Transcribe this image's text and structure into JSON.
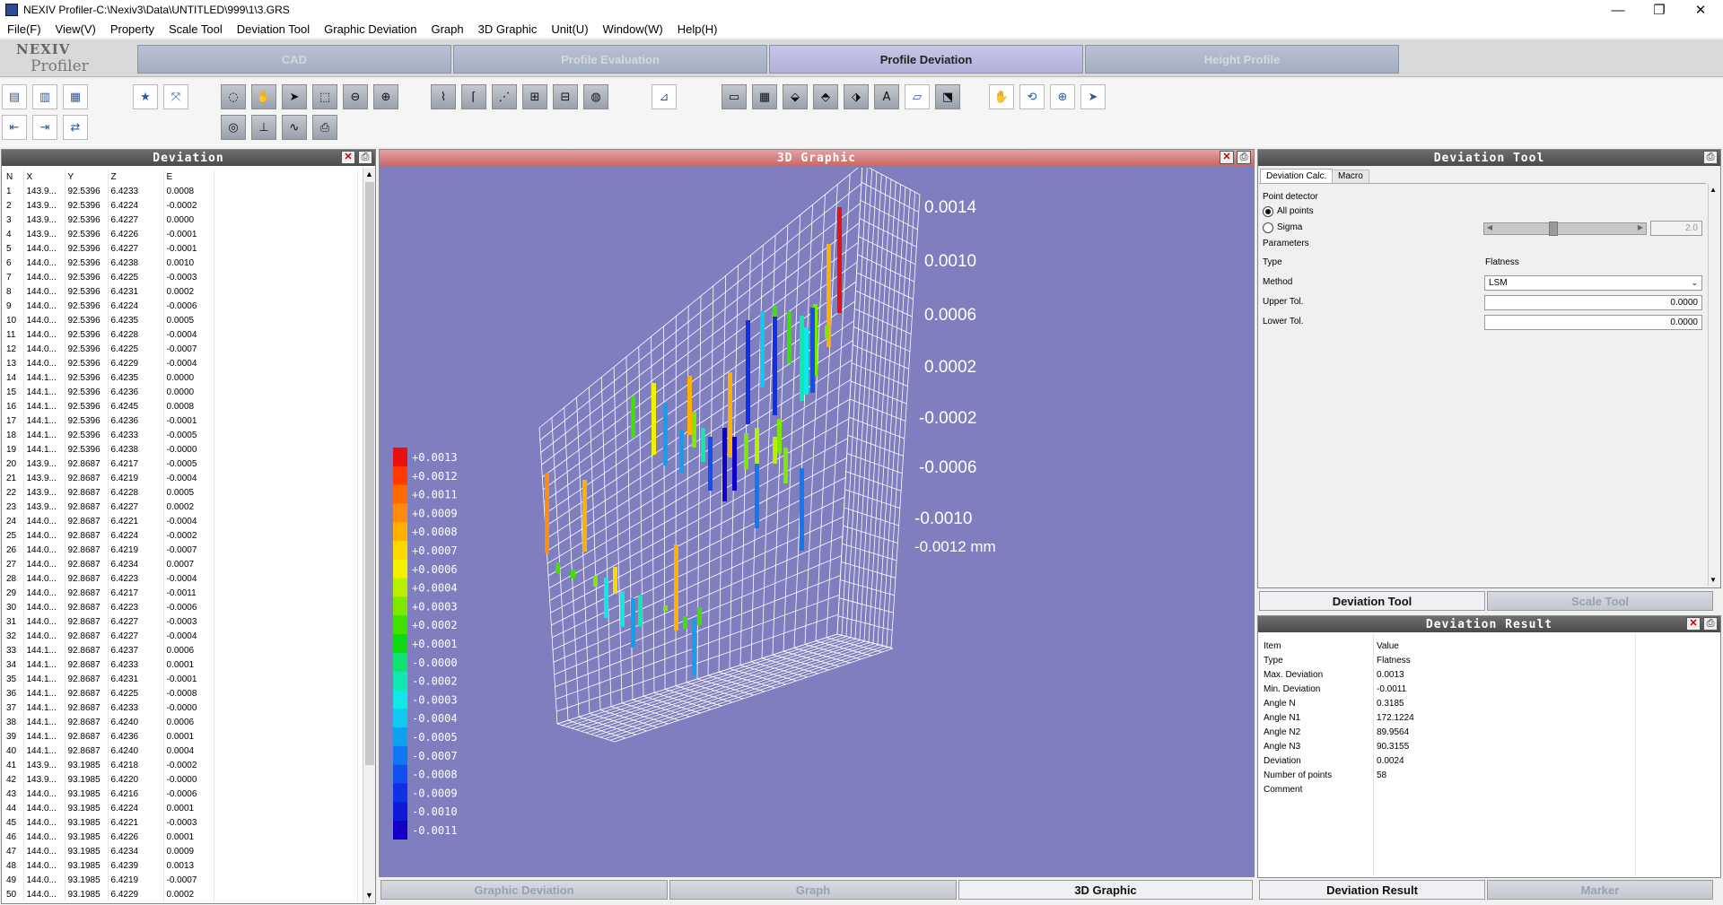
{
  "window": {
    "title": "NEXIV Profiler-C:\\Nexiv3\\Data\\UNTITLED\\999\\1\\3.GRS",
    "minimize": "—",
    "maximize": "❐",
    "close": "✕"
  },
  "menu": [
    "File(F)",
    "View(V)",
    "Property",
    "Scale Tool",
    "Deviation Tool",
    "Graphic Deviation",
    "Graph",
    "3D Graphic",
    "Unit(U)",
    "Window(W)",
    "Help(H)"
  ],
  "logo": {
    "line1": "NEXIV",
    "line2": "Profiler"
  },
  "main_tabs": [
    {
      "label": "CAD"
    },
    {
      "label": "Profile Evaluation"
    },
    {
      "label": "Profile Deviation",
      "active": true
    },
    {
      "label": "Height Profile"
    }
  ],
  "deviation_panel": {
    "title": "Deviation",
    "columns": [
      "N",
      "X",
      "Y",
      "Z",
      "E"
    ],
    "rows": [
      [
        "1",
        "143.9...",
        "92.5396",
        "6.4233",
        "0.0008"
      ],
      [
        "2",
        "143.9...",
        "92.5396",
        "6.4224",
        "-0.0002"
      ],
      [
        "3",
        "143.9...",
        "92.5396",
        "6.4227",
        "0.0000"
      ],
      [
        "4",
        "143.9...",
        "92.5396",
        "6.4226",
        "-0.0001"
      ],
      [
        "5",
        "144.0...",
        "92.5396",
        "6.4227",
        "-0.0001"
      ],
      [
        "6",
        "144.0...",
        "92.5396",
        "6.4238",
        "0.0010"
      ],
      [
        "7",
        "144.0...",
        "92.5396",
        "6.4225",
        "-0.0003"
      ],
      [
        "8",
        "144.0...",
        "92.5396",
        "6.4231",
        "0.0002"
      ],
      [
        "9",
        "144.0...",
        "92.5396",
        "6.4224",
        "-0.0006"
      ],
      [
        "10",
        "144.0...",
        "92.5396",
        "6.4235",
        "0.0005"
      ],
      [
        "11",
        "144.0...",
        "92.5396",
        "6.4228",
        "-0.0004"
      ],
      [
        "12",
        "144.0...",
        "92.5396",
        "6.4225",
        "-0.0007"
      ],
      [
        "13",
        "144.0...",
        "92.5396",
        "6.4229",
        "-0.0004"
      ],
      [
        "14",
        "144.1...",
        "92.5396",
        "6.4235",
        "0.0000"
      ],
      [
        "15",
        "144.1...",
        "92.5396",
        "6.4236",
        "0.0000"
      ],
      [
        "16",
        "144.1...",
        "92.5396",
        "6.4245",
        "0.0008"
      ],
      [
        "17",
        "144.1...",
        "92.5396",
        "6.4236",
        "-0.0001"
      ],
      [
        "18",
        "144.1...",
        "92.5396",
        "6.4233",
        "-0.0005"
      ],
      [
        "19",
        "144.1...",
        "92.5396",
        "6.4238",
        "-0.0000"
      ],
      [
        "20",
        "143.9...",
        "92.8687",
        "6.4217",
        "-0.0005"
      ],
      [
        "21",
        "143.9...",
        "92.8687",
        "6.4219",
        "-0.0004"
      ],
      [
        "22",
        "143.9...",
        "92.8687",
        "6.4228",
        "0.0005"
      ],
      [
        "23",
        "143.9...",
        "92.8687",
        "6.4227",
        "0.0002"
      ],
      [
        "24",
        "144.0...",
        "92.8687",
        "6.4221",
        "-0.0004"
      ],
      [
        "25",
        "144.0...",
        "92.8687",
        "6.4224",
        "-0.0002"
      ],
      [
        "26",
        "144.0...",
        "92.8687",
        "6.4219",
        "-0.0007"
      ],
      [
        "27",
        "144.0...",
        "92.8687",
        "6.4234",
        "0.0007"
      ],
      [
        "28",
        "144.0...",
        "92.8687",
        "6.4223",
        "-0.0004"
      ],
      [
        "29",
        "144.0...",
        "92.8687",
        "6.4217",
        "-0.0011"
      ],
      [
        "30",
        "144.0...",
        "92.8687",
        "6.4223",
        "-0.0006"
      ],
      [
        "31",
        "144.0...",
        "92.8687",
        "6.4227",
        "-0.0003"
      ],
      [
        "32",
        "144.0...",
        "92.8687",
        "6.4227",
        "-0.0004"
      ],
      [
        "33",
        "144.1...",
        "92.8687",
        "6.4237",
        "0.0006"
      ],
      [
        "34",
        "144.1...",
        "92.8687",
        "6.4233",
        "0.0001"
      ],
      [
        "35",
        "144.1...",
        "92.8687",
        "6.4231",
        "-0.0001"
      ],
      [
        "36",
        "144.1...",
        "92.8687",
        "6.4225",
        "-0.0008"
      ],
      [
        "37",
        "144.1...",
        "92.8687",
        "6.4233",
        "-0.0000"
      ],
      [
        "38",
        "144.1...",
        "92.8687",
        "6.4240",
        "0.0006"
      ],
      [
        "39",
        "144.1...",
        "92.8687",
        "6.4236",
        "0.0001"
      ],
      [
        "40",
        "144.1...",
        "92.8687",
        "6.4240",
        "0.0004"
      ],
      [
        "41",
        "143.9...",
        "93.1985",
        "6.4218",
        "-0.0002"
      ],
      [
        "42",
        "143.9...",
        "93.1985",
        "6.4220",
        "-0.0000"
      ],
      [
        "43",
        "144.0...",
        "93.1985",
        "6.4216",
        "-0.0006"
      ],
      [
        "44",
        "144.0...",
        "93.1985",
        "6.4224",
        "0.0001"
      ],
      [
        "45",
        "144.0...",
        "93.1985",
        "6.4221",
        "-0.0003"
      ],
      [
        "46",
        "144.0...",
        "93.1985",
        "6.4226",
        "0.0001"
      ],
      [
        "47",
        "144.0...",
        "93.1985",
        "6.4234",
        "0.0009"
      ],
      [
        "48",
        "144.0...",
        "93.1985",
        "6.4239",
        "0.0013"
      ],
      [
        "49",
        "144.0...",
        "93.1985",
        "6.4219",
        "-0.0007"
      ],
      [
        "50",
        "144.0...",
        "93.1985",
        "6.4229",
        "0.0002"
      ]
    ]
  },
  "graphic_panel": {
    "title": "3D Graphic",
    "color_scale": [
      "+0.0013",
      "+0.0012",
      "+0.0011",
      "+0.0009",
      "+0.0008",
      "+0.0007",
      "+0.0006",
      "+0.0004",
      "+0.0003",
      "+0.0002",
      "+0.0001",
      "-0.0000",
      "-0.0002",
      "-0.0003",
      "-0.0004",
      "-0.0005",
      "-0.0007",
      "-0.0008",
      "-0.0009",
      "-0.0010",
      "-0.0011"
    ],
    "color_scale_colors": [
      "#e81010",
      "#ff3a00",
      "#ff6a00",
      "#ff8c10",
      "#ffb000",
      "#ffd800",
      "#f2f200",
      "#b8f000",
      "#80e800",
      "#40e000",
      "#10d810",
      "#10e070",
      "#10e8b0",
      "#10e8e8",
      "#10c8f0",
      "#10a0f0",
      "#1078f0",
      "#1050f0",
      "#1030e8",
      "#1018d8",
      "#1000c8"
    ],
    "z_axis_labels": [
      "0.0014",
      "0.0010",
      "0.0006",
      "0.0002",
      "-0.0002",
      "-0.0006",
      "-0.0010",
      "-0.0012 mm"
    ],
    "background": "#7f7fc0"
  },
  "graphic_tabs": [
    {
      "label": "Graphic Deviation"
    },
    {
      "label": "Graph"
    },
    {
      "label": "3D Graphic",
      "active": true
    }
  ],
  "tool_panel": {
    "title": "Deviation Tool",
    "subtabs": [
      "Deviation Calc.",
      "Macro"
    ],
    "point_detector": "Point detector",
    "all_points": "All points",
    "sigma": "Sigma",
    "sigma_value": "2.0",
    "parameters": "Parameters",
    "type_label": "Type",
    "type_value": "Flatness",
    "method_label": "Method",
    "method_value": "LSM",
    "upper_label": "Upper Tol.",
    "upper_value": "0.0000",
    "lower_label": "Lower Tol.",
    "lower_value": "0.0000"
  },
  "tool_tabs": [
    {
      "label": "Deviation Tool",
      "active": true
    },
    {
      "label": "Scale Tool"
    }
  ],
  "result_panel": {
    "title": "Deviation Result",
    "header": [
      "Item",
      "Value"
    ],
    "rows": [
      [
        "Type",
        "Flatness"
      ],
      [
        "Max. Deviation",
        "0.0013"
      ],
      [
        "Min. Deviation",
        "-0.0011"
      ],
      [
        "Angle N",
        "0.3185"
      ],
      [
        "Angle N1",
        "172.1224"
      ],
      [
        "Angle N2",
        "89.9564"
      ],
      [
        "Angle N3",
        "90.3155"
      ],
      [
        "Deviation",
        "0.0024"
      ],
      [
        "Number of points",
        "58"
      ],
      [
        "Comment",
        ""
      ]
    ]
  },
  "result_tabs": [
    {
      "label": "Deviation Result",
      "active": true
    },
    {
      "label": "Marker"
    }
  ]
}
